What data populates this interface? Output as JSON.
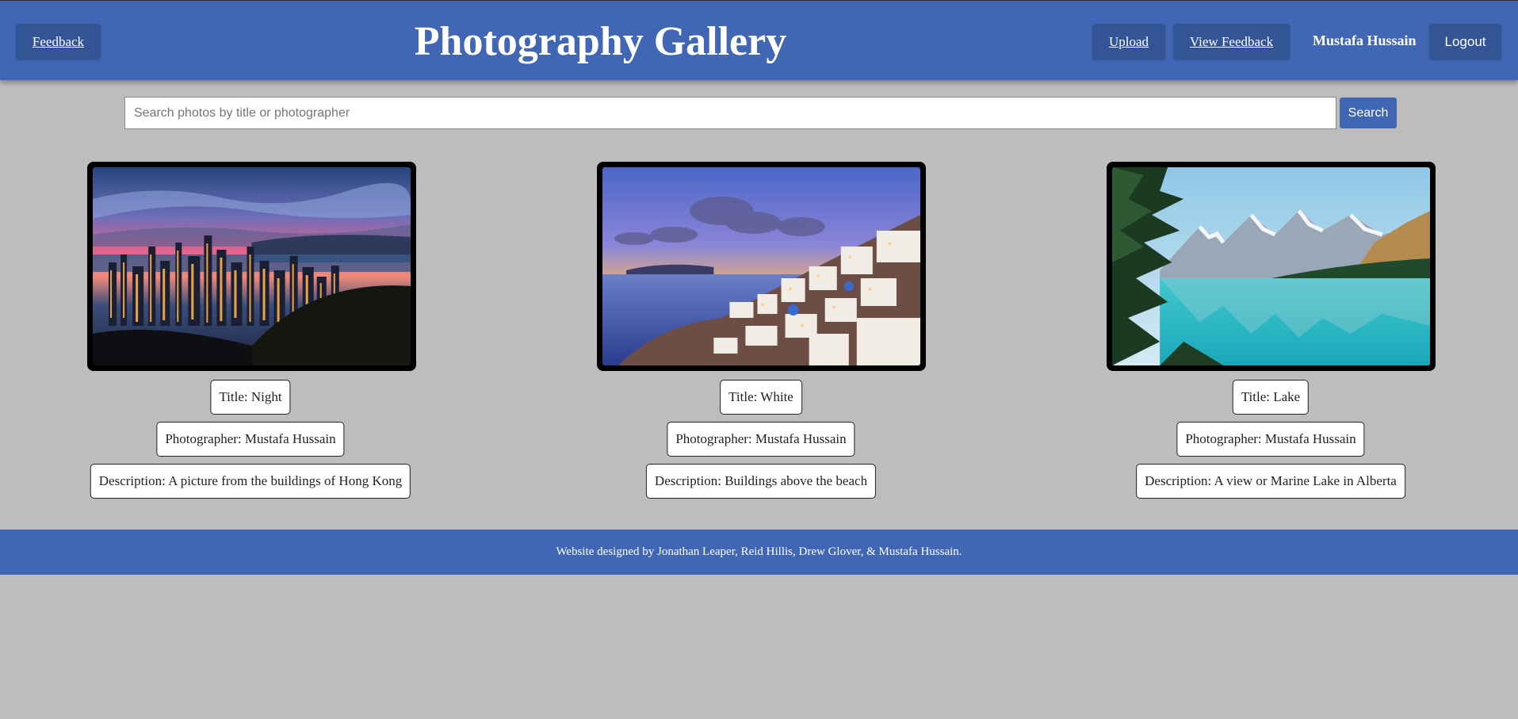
{
  "header": {
    "title": "Photography Gallery",
    "feedback_label": "Feedback",
    "upload_label": "Upload",
    "view_feedback_label": "View Feedback",
    "user_name": "Mustafa Hussain",
    "logout_label": "Logout"
  },
  "search": {
    "placeholder": "Search photos by title or photographer",
    "value": "",
    "button_label": "Search"
  },
  "photos": [
    {
      "title": "Title: Night",
      "photographer": "Photographer: Mustafa Hussain",
      "description": "Description: A picture from the buildings of Hong Kong"
    },
    {
      "title": "Title: White",
      "photographer": "Photographer: Mustafa Hussain",
      "description": "Description: Buildings above the beach"
    },
    {
      "title": "Title: Lake",
      "photographer": "Photographer: Mustafa Hussain",
      "description": "Description: A view or Marine Lake in Alberta"
    }
  ],
  "footer": {
    "text": "Website designed by Jonathan Leaper, Reid Hillis, Drew Glover, & Mustafa Hussain."
  },
  "colors": {
    "header_bg": "#4066b4",
    "button_bg": "#335596",
    "page_bg": "#bdbdbd"
  }
}
